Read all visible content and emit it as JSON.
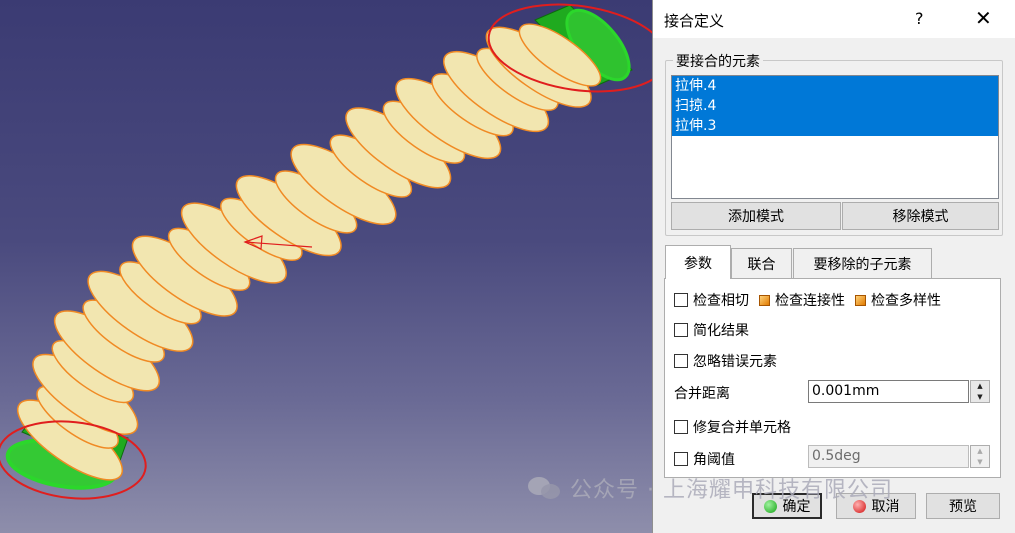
{
  "dialog": {
    "title": "接合定义",
    "help": "?",
    "close": "✕",
    "elements_group_label": "要接合的元素",
    "elements": [
      {
        "label": "拉伸.4"
      },
      {
        "label": "扫掠.4"
      },
      {
        "label": "拉伸.3"
      }
    ],
    "add_mode_label": "添加模式",
    "remove_mode_label": "移除模式",
    "tabs": [
      {
        "label": "参数",
        "active": true
      },
      {
        "label": "联合",
        "active": false
      },
      {
        "label": "要移除的子元素",
        "active": false
      }
    ],
    "params": {
      "check_tangency": "检查相切",
      "check_connectivity": "检查连接性",
      "check_manifold": "检查多样性",
      "simplify_result": "简化结果",
      "ignore_erroneous": "忽略错误元素",
      "merging_distance_label": "合并距离",
      "merging_distance_value": "0.001mm",
      "heal_merged_cells": "修复合并单元格",
      "angular_threshold_label": "角阈值",
      "angular_threshold_value": "0.5deg"
    },
    "ok_label": "确定",
    "cancel_label": "取消",
    "preview_label": "预览"
  },
  "watermark": {
    "text": "公众号 · 上海耀申科技有限公司"
  },
  "colors": {
    "selection": "#0078d7",
    "part": "#f2e6b0",
    "edge": "#f08a24",
    "highlight_green": "#2bd72b",
    "annotation_red": "#e01e1e"
  }
}
